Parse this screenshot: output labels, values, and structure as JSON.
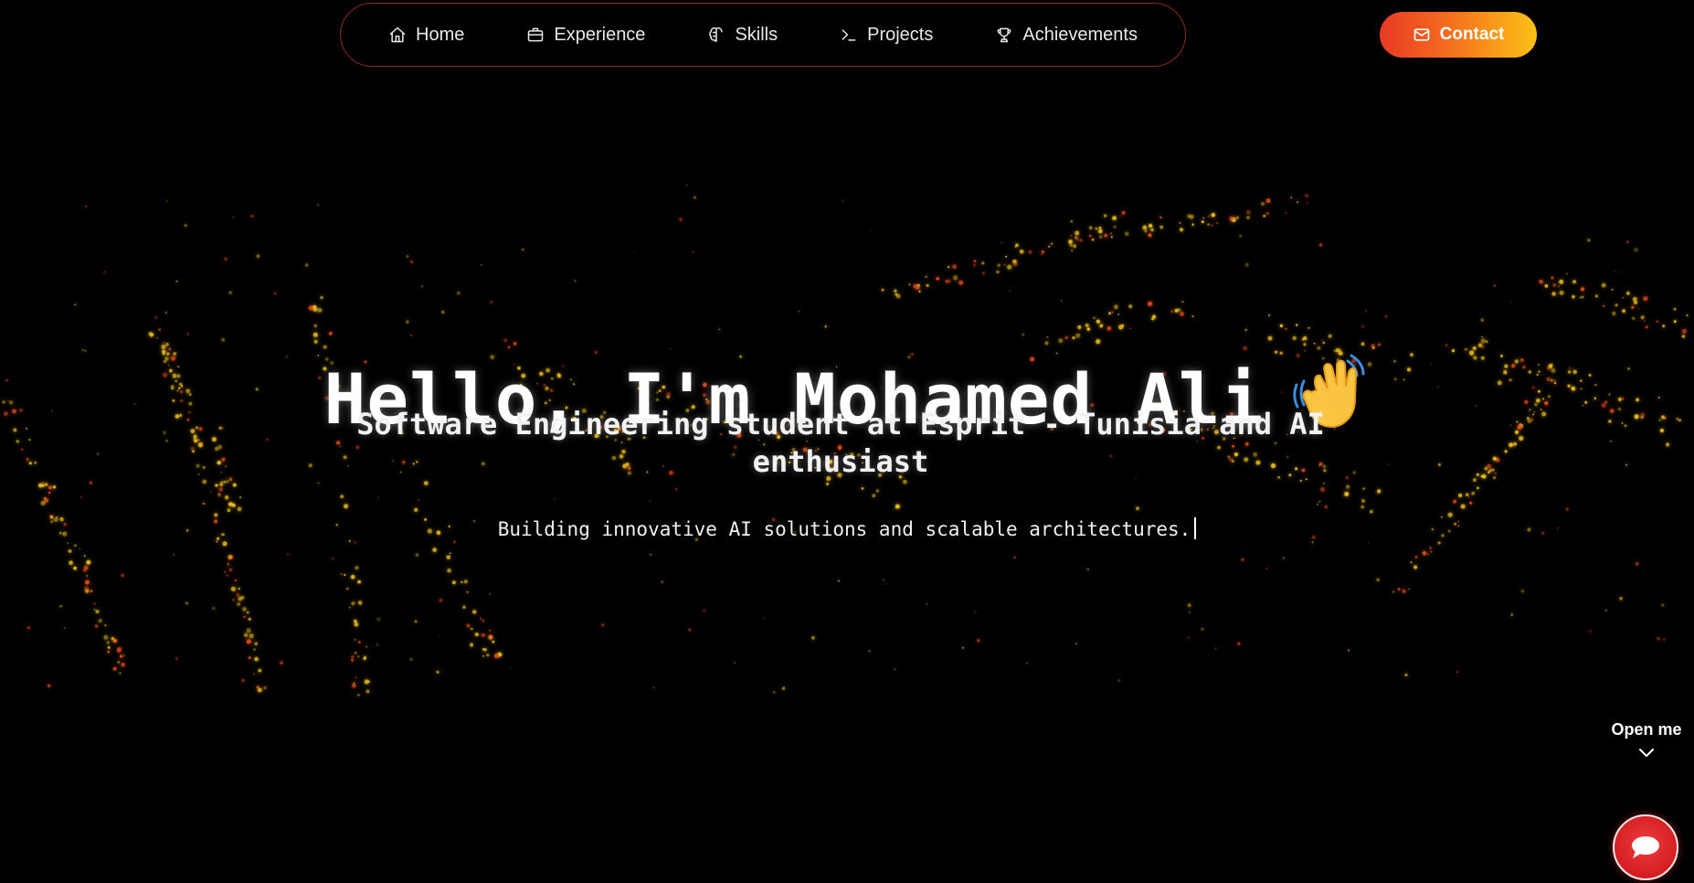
{
  "nav": {
    "items": [
      {
        "label": "Home",
        "icon": "home-icon"
      },
      {
        "label": "Experience",
        "icon": "briefcase-icon"
      },
      {
        "label": "Skills",
        "icon": "brain-icon"
      },
      {
        "label": "Projects",
        "icon": "terminal-icon"
      },
      {
        "label": "Achievements",
        "icon": "trophy-icon"
      }
    ],
    "contact_label": "Contact",
    "contact_icon": "mail-icon"
  },
  "hero": {
    "title": "Hello, I'm Mohamed Ali",
    "title_icon": "waving-hand-icon",
    "subtitle": "Software Engineering student at Esprit - Tunisia and AI enthusiast",
    "tagline": "Building innovative AI solutions and scalable architectures."
  },
  "widget": {
    "open_label": "Open me",
    "open_icon": "chevron-down-icon",
    "chat_icon": "chat-bubble-icon"
  },
  "colors": {
    "background": "#000000",
    "nav_border": "#8b2a1c",
    "contact_gradient_start": "#ea3a25",
    "contact_gradient_end": "#fcc216",
    "chat_button": "#d61e22",
    "particle_yellow": "#f2c21b",
    "particle_red": "#e84a1a"
  }
}
